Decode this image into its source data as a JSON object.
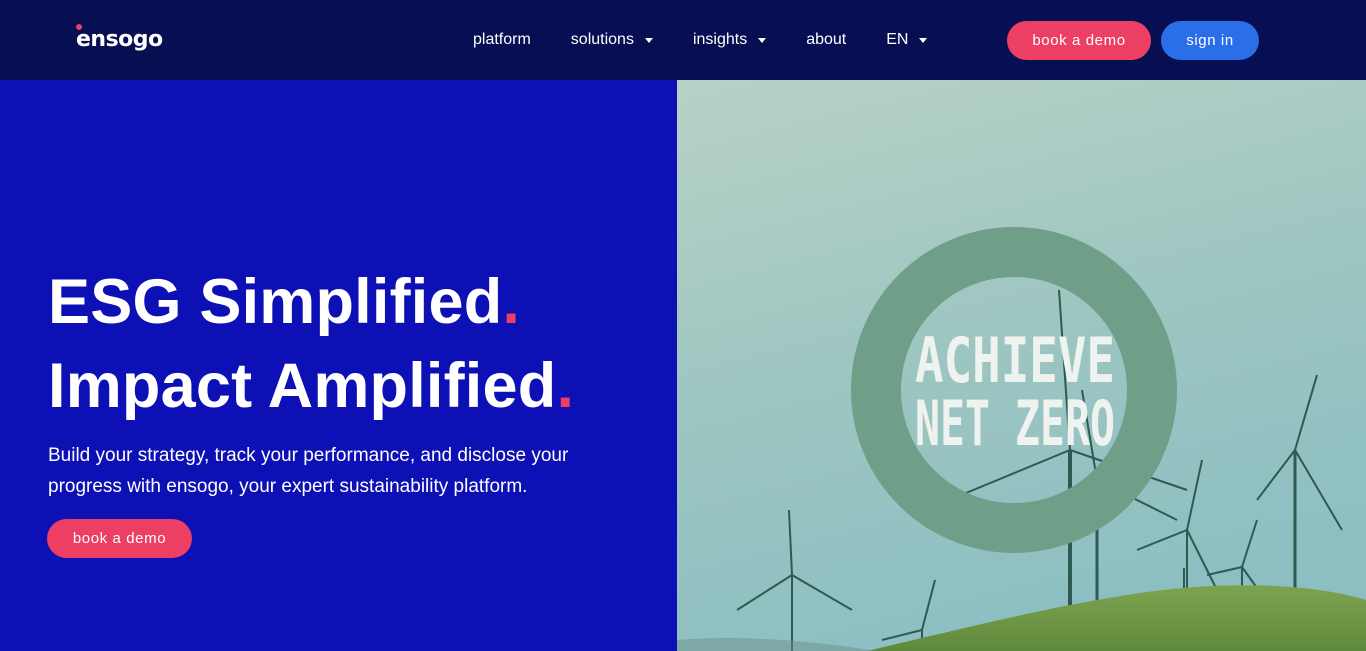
{
  "brand": {
    "name": "ensogo",
    "accent_color": "#ed3f64"
  },
  "nav": {
    "items": [
      {
        "label": "platform",
        "has_dropdown": false
      },
      {
        "label": "solutions",
        "has_dropdown": true
      },
      {
        "label": "insights",
        "has_dropdown": true
      },
      {
        "label": "about",
        "has_dropdown": false
      },
      {
        "label": "EN",
        "has_dropdown": true
      }
    ],
    "book_demo_label": "book a demo",
    "sign_in_label": "sign in"
  },
  "hero": {
    "headline_line1": "ESG Simplified",
    "headline_line2": "Impact Amplified",
    "headline_dot": ".",
    "subtitle": "Build your strategy, track your performance, and disclose your progress with ensogo, your expert sustainability platform.",
    "cta_label": "book a demo",
    "image": {
      "ring_text_line1": "ACHIEVE",
      "ring_text_line2": "NET ZERO",
      "scene": "wind turbines on green hill"
    }
  },
  "colors": {
    "navbar_bg": "#070e52",
    "hero_bg": "#0c10b5",
    "demo_button": "#ed3f64",
    "signin_button": "#2a6ee8",
    "ring": "#6f9f88"
  }
}
